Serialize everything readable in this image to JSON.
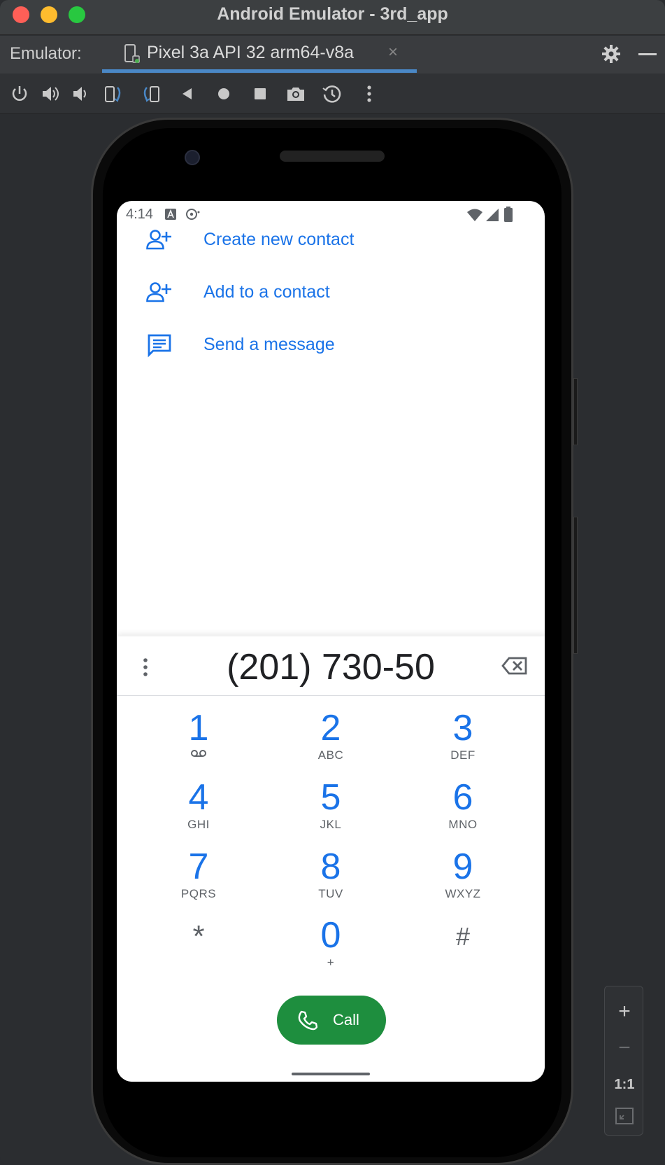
{
  "window": {
    "title": "Android Emulator - 3rd_app"
  },
  "tabbar": {
    "prefix": "Emulator:",
    "tab_label": "Pixel 3a API 32 arm64-v8a",
    "close_glyph": "×"
  },
  "toolbar": {
    "icons": [
      "power-icon",
      "volume-up-icon",
      "volume-down-icon",
      "rotate-left-icon",
      "rotate-right-icon",
      "back-icon",
      "home-icon",
      "overview-icon",
      "camera-icon",
      "snapshot-icon",
      "more-icon"
    ]
  },
  "status": {
    "time": "4:14"
  },
  "menu": {
    "items": [
      {
        "label": "Create new contact",
        "icon": "add-person-icon"
      },
      {
        "label": "Add to a contact",
        "icon": "add-person-icon"
      },
      {
        "label": "Send a message",
        "icon": "message-icon"
      }
    ]
  },
  "dialpad": {
    "number": "(201) 730-50",
    "keys": [
      {
        "digit": "1",
        "letters": ""
      },
      {
        "digit": "2",
        "letters": "ABC"
      },
      {
        "digit": "3",
        "letters": "DEF"
      },
      {
        "digit": "4",
        "letters": "GHI"
      },
      {
        "digit": "5",
        "letters": "JKL"
      },
      {
        "digit": "6",
        "letters": "MNO"
      },
      {
        "digit": "7",
        "letters": "PQRS"
      },
      {
        "digit": "8",
        "letters": "TUV"
      },
      {
        "digit": "9",
        "letters": "WXYZ"
      },
      {
        "digit": "*",
        "letters": ""
      },
      {
        "digit": "0",
        "letters": "+"
      },
      {
        "digit": "#",
        "letters": ""
      }
    ],
    "call_label": "Call"
  },
  "zoom": {
    "plus": "+",
    "minus": "−",
    "actual": "1:1"
  },
  "colors": {
    "accent": "#1a73e8",
    "call_green": "#1e8e3e",
    "tab_underline": "#4a88c7"
  }
}
